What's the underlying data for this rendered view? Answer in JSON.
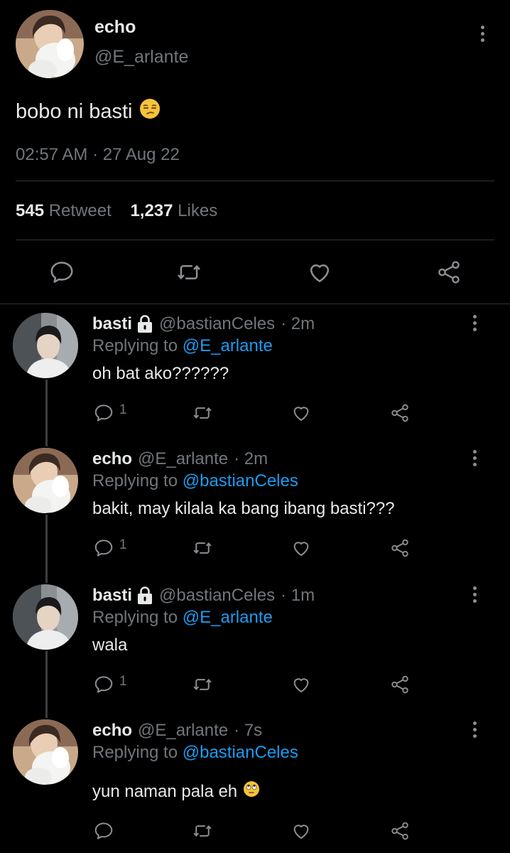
{
  "main_tweet": {
    "display_name": "echo",
    "handle": "@E_arlante",
    "text": "bobo ni basti",
    "emoji": "unamused-face-emoji",
    "timestamp": "02:57 AM · 27 Aug 22",
    "retweets_count": "545",
    "retweets_label": "Retweet",
    "likes_count": "1,237",
    "likes_label": "Likes",
    "actions": [
      "reply-icon",
      "retweet-icon",
      "like-icon",
      "share-icon"
    ]
  },
  "replies": [
    {
      "display_name": "basti",
      "protected": true,
      "handle": "@bastianCeles",
      "time": "· 2m",
      "replying_prefix": "Replying to",
      "replying_to": "@E_arlante",
      "text": "oh bat ako??????",
      "reply_count": "1"
    },
    {
      "display_name": "echo",
      "protected": false,
      "handle": "@E_arlante",
      "time": "· 2m",
      "replying_prefix": "Replying to",
      "replying_to": "@bastianCeles",
      "text": "bakit, may kilala ka bang ibang basti???",
      "reply_count": "1"
    },
    {
      "display_name": "basti",
      "protected": true,
      "handle": "@bastianCeles",
      "time": "· 1m",
      "replying_prefix": "Replying to",
      "replying_to": "@E_arlante",
      "text": "wala",
      "reply_count": "1"
    },
    {
      "display_name": "echo",
      "protected": false,
      "handle": "@E_arlante",
      "time": "· 7s",
      "replying_prefix": "Replying to",
      "replying_to": "@bastianCeles",
      "text": "yun naman pala eh",
      "emoji": "rolling-eyes-emoji",
      "reply_count": ""
    }
  ],
  "colors": {
    "background": "#000000",
    "text_primary": "#e7e9ea",
    "text_secondary": "#71767b",
    "link": "#1d9bf0",
    "divider": "#2f3336"
  }
}
